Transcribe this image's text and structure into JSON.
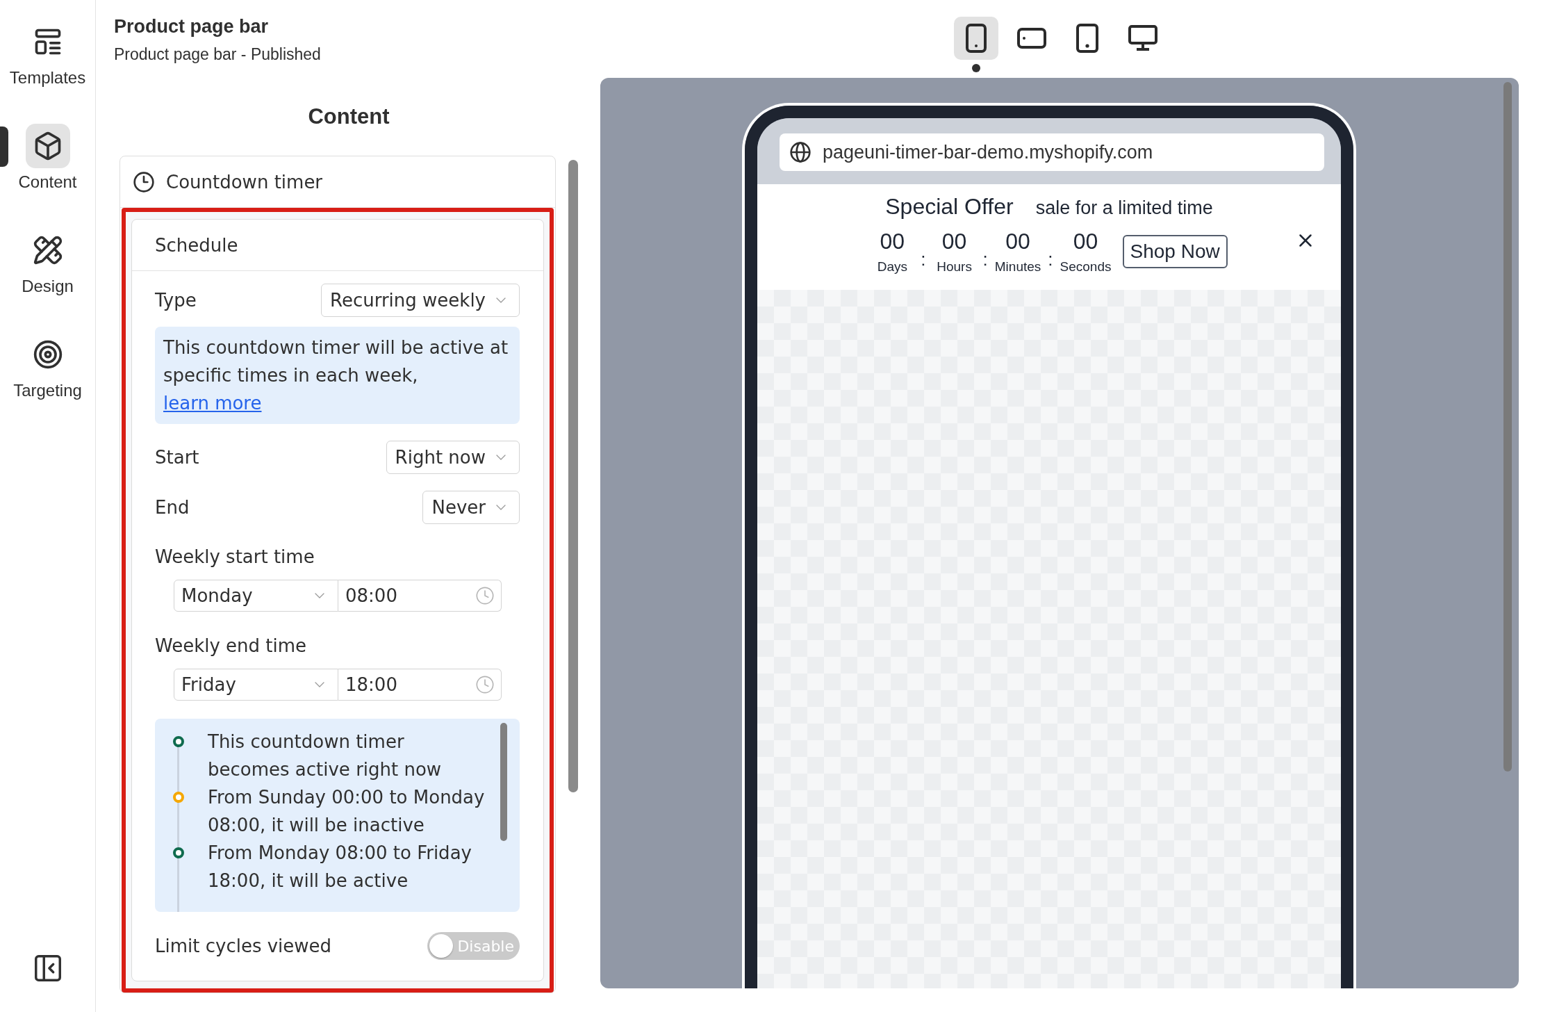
{
  "nav": {
    "items": [
      {
        "label": "Templates",
        "selected": false
      },
      {
        "label": "Content",
        "selected": true
      },
      {
        "label": "Design",
        "selected": false
      },
      {
        "label": "Targeting",
        "selected": false
      }
    ]
  },
  "header": {
    "title": "Product page bar",
    "subtitle": "Product page bar - Published"
  },
  "panel": {
    "heading": "Content",
    "section": "Countdown timer",
    "schedule": {
      "title": "Schedule",
      "type": {
        "label": "Type",
        "value": "Recurring weekly"
      },
      "info": {
        "text": "This countdown timer will be active at specific times in each week,",
        "link": "learn more"
      },
      "start": {
        "label": "Start",
        "value": "Right now"
      },
      "end": {
        "label": "End",
        "value": "Never"
      },
      "weekly_start": {
        "label": "Weekly start time",
        "day": "Monday",
        "time": "08:00"
      },
      "weekly_end": {
        "label": "Weekly end time",
        "day": "Friday",
        "time": "18:00"
      },
      "timeline": [
        {
          "text": "This countdown timer becomes active right now",
          "color": "#0f6b4e"
        },
        {
          "text": "From Sunday 00:00 to Monday 08:00, it will be inactive",
          "color": "#f5a700"
        },
        {
          "text": "From Monday 08:00 to Friday 18:00, it will be active",
          "color": "#0f6b4e"
        }
      ],
      "limit": {
        "label": "Limit cycles viewed",
        "toggle": "Disable",
        "on": false
      }
    }
  },
  "devices": [
    {
      "selected": true
    },
    {
      "selected": false
    },
    {
      "selected": false
    },
    {
      "selected": false
    }
  ],
  "preview": {
    "url": "pageuni-timer-bar-demo.myshopify.com",
    "bar": {
      "title": "Special Offer",
      "subtitle": "sale for a limited time",
      "countdown": [
        {
          "value": "00",
          "label": "Days"
        },
        {
          "value": "00",
          "label": "Hours"
        },
        {
          "value": "00",
          "label": "Minutes"
        },
        {
          "value": "00",
          "label": "Seconds"
        }
      ],
      "separators": [
        ":",
        ":",
        ":"
      ],
      "button": "Shop Now"
    }
  }
}
